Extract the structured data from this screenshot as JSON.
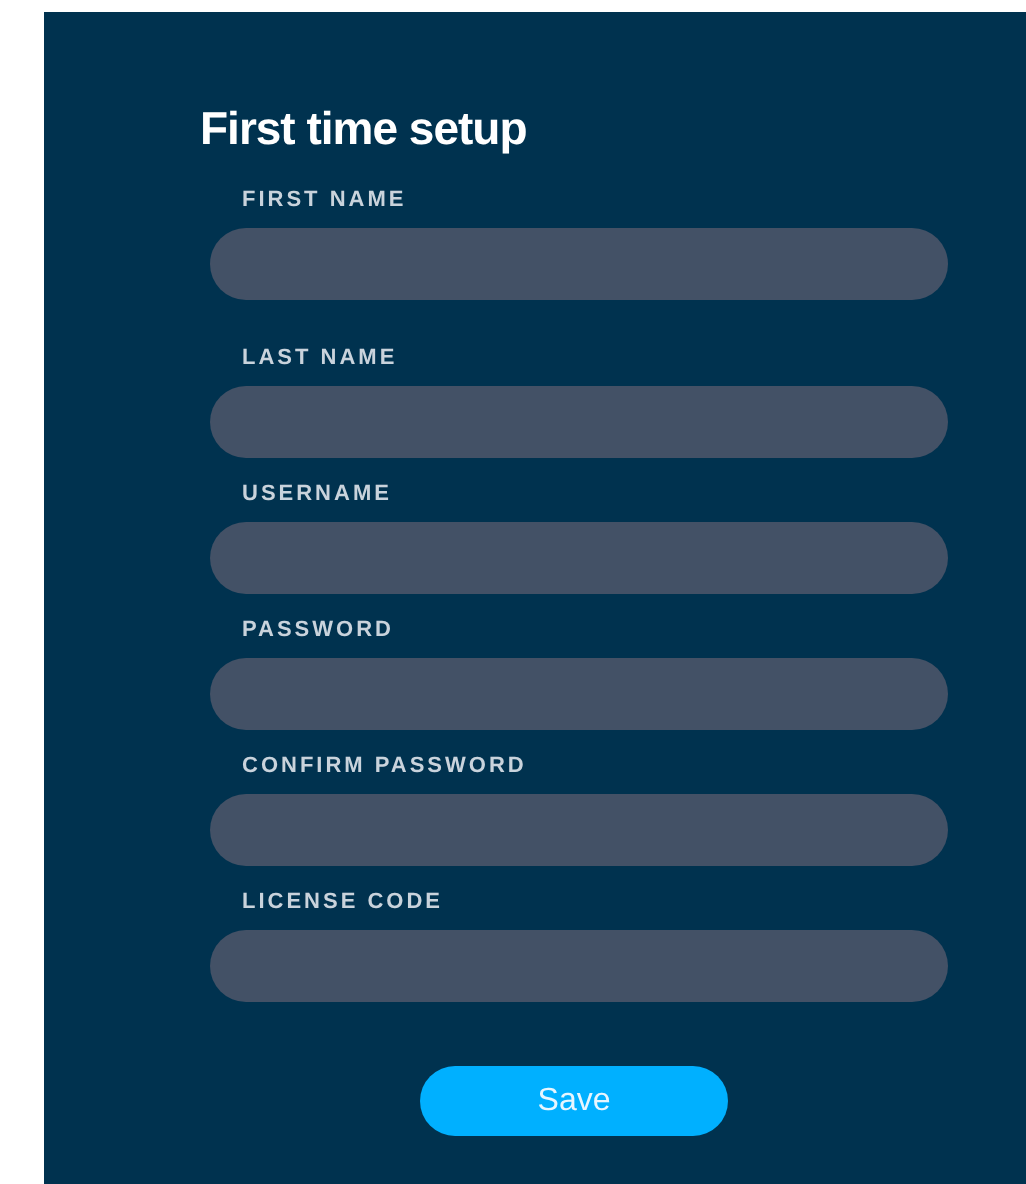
{
  "title": "First time setup",
  "fields": [
    {
      "label": "FIRST NAME"
    },
    {
      "label": "LAST NAME"
    },
    {
      "label": "USERNAME"
    },
    {
      "label": "PASSWORD"
    },
    {
      "label": "CONFIRM PASSWORD"
    },
    {
      "label": "LICENSE CODE"
    }
  ],
  "save_button": "Save"
}
